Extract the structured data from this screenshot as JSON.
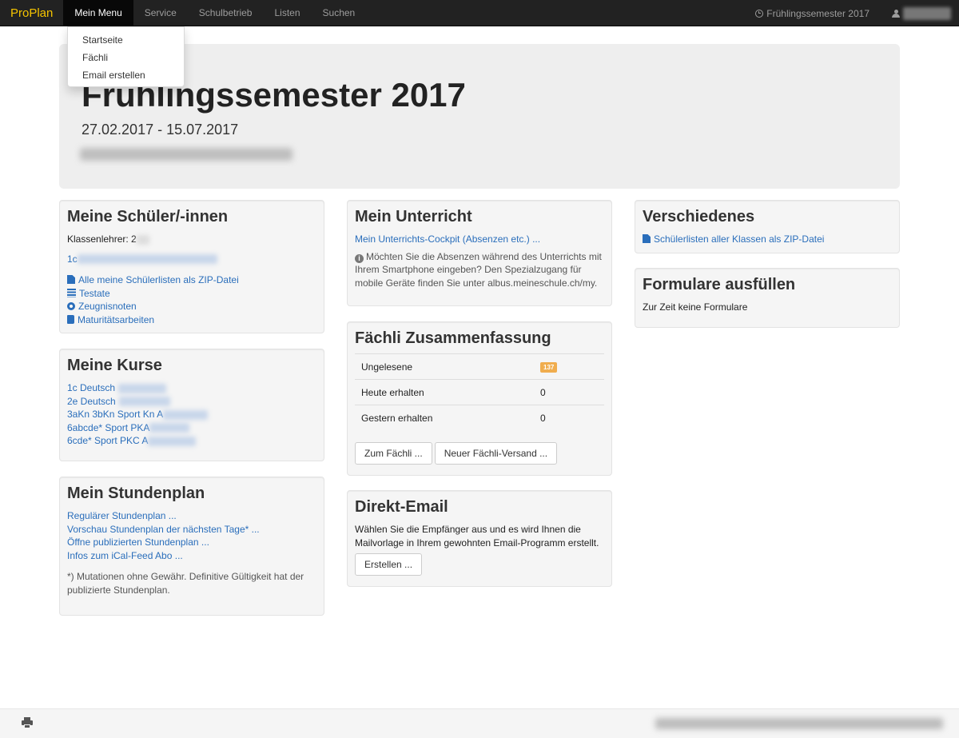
{
  "navbar": {
    "brand": "ProPlan",
    "items": [
      "Mein Menu",
      "Service",
      "Schulbetrieb",
      "Listen",
      "Suchen"
    ],
    "semester": "Frühlingssemester 2017",
    "brand_color": "#f5c400"
  },
  "dropdown": {
    "items": [
      "Startseite",
      "Fächli",
      "Email erstellen"
    ]
  },
  "jumbotron": {
    "title": "Frühlingssemester 2017",
    "dates": "27.02.2017 - 15.07.2017"
  },
  "schueler": {
    "title": "Meine Schüler/-innen",
    "klassenlehrer_label": "Klassenlehrer: 2",
    "klasse": "1c",
    "links": [
      {
        "label": "Alle meine Schülerlisten als ZIP-Datei",
        "icon": "file-icon"
      },
      {
        "label": "Testate",
        "icon": "list-icon"
      },
      {
        "label": "Zeugnisnoten",
        "icon": "gear-icon"
      },
      {
        "label": "Maturitätsarbeiten",
        "icon": "book-icon"
      }
    ]
  },
  "kurse": {
    "title": "Meine Kurse",
    "items": [
      "1c Deutsch",
      "2e Deutsch",
      "3aKn 3bKn Sport Kn A",
      "6abcde* Sport PKA",
      "6cde* Sport PKC A"
    ]
  },
  "stundenplan": {
    "title": "Mein Stundenplan",
    "links": [
      "Regulärer Stundenplan ...",
      "Vorschau Stundenplan der nächsten Tage* ...",
      "Öffne publizierten Stundenplan ...",
      "Infos zum iCal-Feed Abo ..."
    ],
    "note": "*) Mutationen ohne Gewähr. Definitive Gültigkeit hat der publizierte Stundenplan."
  },
  "unterricht": {
    "title": "Mein Unterricht",
    "cockpit_link": "Mein Unterrichts-Cockpit (Absenzen etc.) ...",
    "info": "Möchten Sie die Absenzen während des Unterrichts mit Ihrem Smartphone eingeben? Den Spezialzugang für mobile Geräte finden Sie unter albus.meineschule.ch/my."
  },
  "faechli": {
    "title": "Fächli Zusammenfassung",
    "rows": [
      {
        "label": "Ungelesene",
        "value": "137"
      },
      {
        "label": "Heute erhalten",
        "value": "0"
      },
      {
        "label": "Gestern erhalten",
        "value": "0"
      }
    ],
    "btn_open": "Zum Fächli ...",
    "btn_new": "Neuer Fächli-Versand ..."
  },
  "direkt_email": {
    "title": "Direkt-Email",
    "text": "Wählen Sie die Empfänger aus und es wird Ihnen die Mailvorlage in Ihrem gewohnten Email-Programm erstellt.",
    "button": "Erstellen ..."
  },
  "verschiedenes": {
    "title": "Verschiedenes",
    "link": "Schülerlisten aller Klassen als ZIP-Datei"
  },
  "formulare": {
    "title": "Formulare ausfüllen",
    "text": "Zur Zeit keine Formulare"
  }
}
